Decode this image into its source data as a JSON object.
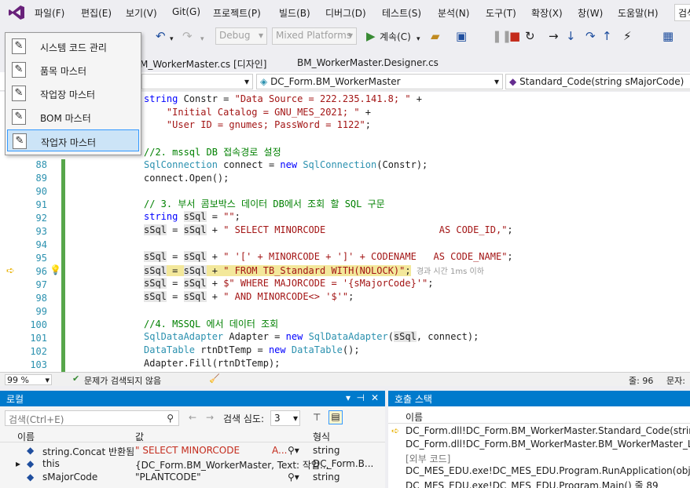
{
  "menubar": {
    "items": [
      "파일(F)",
      "편집(E)",
      "보기(V)",
      "Git(G)",
      "프로젝트(P)",
      "빌드(B)",
      "디버그(D)",
      "테스트(S)",
      "분석(N)",
      "도구(T)",
      "확장(X)",
      "창(W)",
      "도움말(H)"
    ],
    "search_text": "검색"
  },
  "toolbar": {
    "config": "Debug",
    "platform": "Mixed Platforms",
    "continue_label": "계속(C)"
  },
  "tabs": [
    {
      "label": "M_WorkerMaster.cs [디자인]"
    },
    {
      "label": "BM_WorkerMaster.Designer.cs"
    }
  ],
  "navbar": {
    "class": "DC_Form.BM_WorkerMaster",
    "member": "Standard_Code(string sMajorCode)"
  },
  "context_menu": [
    {
      "label": "시스템 코드 관리",
      "icon": "edit-icon"
    },
    {
      "label": "품목 마스터",
      "icon": "edit-icon"
    },
    {
      "label": "작업장 마스터",
      "icon": "edit-icon"
    },
    {
      "label": "BOM 마스터",
      "icon": "edit-icon"
    },
    {
      "label": "작업자 마스터",
      "icon": "edit-icon",
      "selected": true
    }
  ],
  "code": {
    "line_a": "string Constr = \"Data Source = 222.235.141.8; \" +",
    "line_b": "    \"Initial Catalog = GNU_MES_2021; \" +",
    "line_c": "    \"User ID = gnumes; PassWord = 1122\";",
    "l87": "//2. mssql DB 접속경로 설정",
    "l88": "SqlConnection connect = new SqlConnection(Constr);",
    "l89": "connect.Open();",
    "l91": "// 3. 부서 콤보박스 데이터 DB에서 조회 할 SQL 구문",
    "l92": "string sSql = \"\";",
    "l93": "sSql = sSql + \" SELECT MINORCODE                    AS CODE_ID,\";",
    "l95": "sSql = sSql + \" '[' + MINORCODE + ']' + CODENAME   AS CODE_NAME\";",
    "l96": "sSql = sSql + \" FROM TB_Standard WITH(NOLOCK)\";",
    "l96_hint": "경과 시간 1ms 이하",
    "l97": "sSql = sSql + $\" WHERE MAJORCODE = '{sMajorCode}'\";",
    "l98": "sSql = sSql + \" AND MINORCODE<> '$'\";",
    "l100": "//4. MSSQL 에서 데이터 조회",
    "l101": "SqlDataAdapter Adapter = new SqlDataAdapter(sSql, connect);",
    "l102": "DataTable rtnDtTemp = new DataTable();",
    "l103": "Adapter.Fill(rtnDtTemp);",
    "line_numbers": [
      "88",
      "89",
      "90",
      "91",
      "92",
      "93",
      "94",
      "95",
      "96",
      "97",
      "98",
      "99",
      "100",
      "101",
      "102",
      "103"
    ]
  },
  "status": {
    "zoom": "99 %",
    "issues": "문제가 검색되지 않음",
    "line": "줄: 96",
    "char": "문자:"
  },
  "locals": {
    "title": "로컬",
    "search_placeholder": "검색(Ctrl+E)",
    "depth_label": "검색 심도:",
    "depth_value": "3",
    "col_name": "이름",
    "col_value": "값",
    "col_type": "형식",
    "rows": [
      {
        "name": "string.Concat 반환됨",
        "value": "\" SELECT MINORCODE",
        "value_tail": "A...",
        "type": "string"
      },
      {
        "name": "this",
        "value": "{DC_Form.BM_WorkerMaster, Text: 작업...",
        "value_tail": "",
        "type": "DC_Form.B..."
      },
      {
        "name": "sMajorCode",
        "value": "\"PLANTCODE\"",
        "value_tail": "",
        "type": "string"
      }
    ]
  },
  "callstack": {
    "title": "호출 스택",
    "col_name": "이름",
    "rows": [
      "DC_Form.dll!DC_Form.BM_WorkerMaster.Standard_Code(string sMaj",
      "DC_Form.dll!DC_Form.BM_WorkerMaster.BM_WorkerMaster_Load(ob",
      "[외부 코드]",
      "DC_MES_EDU.exe!DC_MES_EDU.Program.RunApplication(object[] arg",
      "DC_MES_EDU.exe!DC_MES_EDU.Program.Main() 줄 89"
    ]
  }
}
